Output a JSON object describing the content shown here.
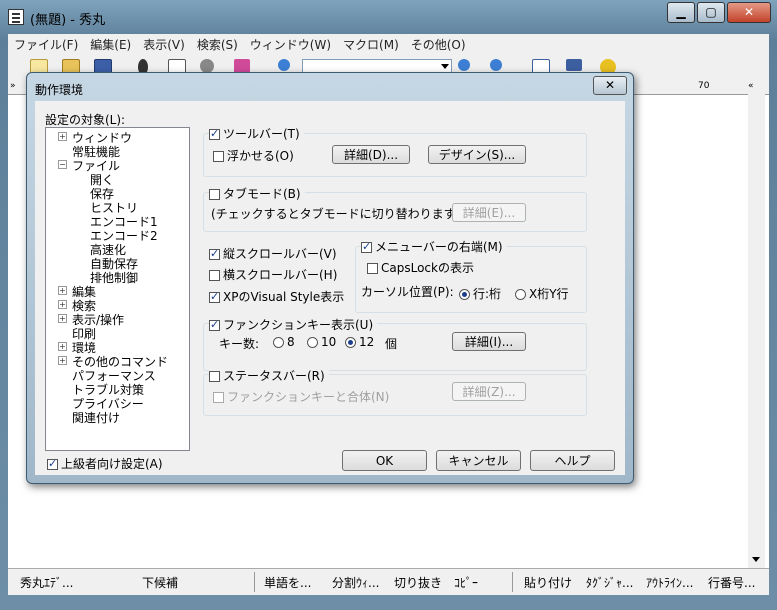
{
  "window": {
    "title": "(無題) - 秀丸",
    "buttons": {
      "minimize": "▁",
      "maximize": "▢",
      "close": "✕"
    }
  },
  "menu": [
    "ファイル(F)",
    "編集(E)",
    "表示(V)",
    "検索(S)",
    "ウィンドウ(W)",
    "マクロ(M)",
    "その他(O)"
  ],
  "ruler": {
    "mark": "70",
    "left_marker": "»",
    "right_marker": "«"
  },
  "status": [
    "秀丸ｴﾃﾞ...",
    "下候補",
    "単語を...",
    "分割ｳｨ...",
    "切り抜き",
    "ｺﾋﾟｰ",
    "貼り付け",
    "ﾀｸﾞｼﾞｬ...",
    "ｱｳﾄﾗｲﾝ...",
    "行番号..."
  ],
  "dialog": {
    "title": "動作環境",
    "close": "✕",
    "target_label": "設定の対象(L):",
    "tree": [
      {
        "label": "ウィンドウ",
        "exp": "+"
      },
      {
        "label": "常駐機能",
        "exp": ""
      },
      {
        "label": "ファイル",
        "exp": "−"
      },
      {
        "label": "開く",
        "exp": ""
      },
      {
        "label": "保存",
        "exp": ""
      },
      {
        "label": "ヒストリ",
        "exp": ""
      },
      {
        "label": "エンコード1",
        "exp": ""
      },
      {
        "label": "エンコード2",
        "exp": ""
      },
      {
        "label": "高速化",
        "exp": ""
      },
      {
        "label": "自動保存",
        "exp": ""
      },
      {
        "label": "排他制御",
        "exp": ""
      },
      {
        "label": "編集",
        "exp": "+"
      },
      {
        "label": "検索",
        "exp": "+"
      },
      {
        "label": "表示/操作",
        "exp": "+"
      },
      {
        "label": "印刷",
        "exp": ""
      },
      {
        "label": "環境",
        "exp": "+"
      },
      {
        "label": "その他のコマンド",
        "exp": "+"
      },
      {
        "label": "パフォーマンス",
        "exp": ""
      },
      {
        "label": "トラブル対策",
        "exp": ""
      },
      {
        "label": "プライバシー",
        "exp": ""
      },
      {
        "label": "関連付け",
        "exp": ""
      }
    ],
    "advanced": "上級者向け設定(A)",
    "toolbar_cb": "ツールバー(T)",
    "float_cb": "浮かせる(O)",
    "detail_btn": "詳細(D)...",
    "design_btn": "デザイン(S)...",
    "tabmode_cb": "タブモード(B)",
    "tabmode_note": "(チェックするとタブモードに切り替わります)",
    "tab_detail_btn": "詳細(E)...",
    "vscroll_cb": "縦スクロールバー(V)",
    "hscroll_cb": "横スクロールバー(H)",
    "xp_cb": "XPのVisual Style表示",
    "menubar_right_cb": "メニューバーの右端(M)",
    "capslock_cb": "CapsLockの表示",
    "cursor_pos_label": "カーソル位置(P):",
    "cursor_opt1": "行:桁",
    "cursor_opt2": "X桁Y行",
    "fkey_cb": "ファンクションキー表示(U)",
    "key_count_label": "キー数:",
    "key_opts": [
      "8",
      "10",
      "12"
    ],
    "key_unit": "個",
    "fkey_detail_btn": "詳細(I)...",
    "statusbar_cb": "ステータスバー(R)",
    "combine_cb": "ファンクションキーと合体(N)",
    "status_detail_btn": "詳細(Z)...",
    "ok": "OK",
    "cancel": "キャンセル",
    "help": "ヘルプ"
  }
}
